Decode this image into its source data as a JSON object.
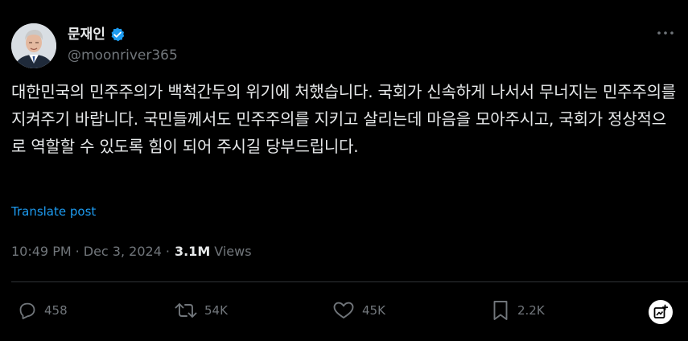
{
  "author": {
    "display_name": "문재인",
    "handle": "@moonriver365",
    "verified": true,
    "verified_color": "#1d9bf0"
  },
  "menu": {
    "icon": "more-horizontal-icon"
  },
  "tweet": {
    "text": "대한민국의 민주주의가 백척간두의 위기에 처했습니다. 국회가 신속하게 나서서 무너지는 민주주의를 지켜주기 바랍니다. 국민들께서도 민주주의를 지키고 살리는데 마음을 모아주시고, 국회가 정상적으로 역할할 수 있도록 힘이 되어 주시길 당부드립니다.",
    "translate_label": "Translate post"
  },
  "meta": {
    "time": "10:49 PM",
    "separator": "·",
    "date": "Dec 3, 2024",
    "views_count": "3.1M",
    "views_label": "Views"
  },
  "actions": {
    "reply": {
      "icon": "reply-icon",
      "count": "458"
    },
    "repost": {
      "icon": "repost-icon",
      "count": "54K"
    },
    "like": {
      "icon": "heart-icon",
      "count": "45K"
    },
    "bookmark": {
      "icon": "bookmark-icon",
      "count": "2.2K"
    },
    "share": {
      "icon": "share-icon"
    }
  },
  "colors": {
    "background": "#000000",
    "text": "#e7e9ea",
    "muted": "#71767b",
    "accent": "#1d9bf0",
    "divider": "#2f3336"
  }
}
